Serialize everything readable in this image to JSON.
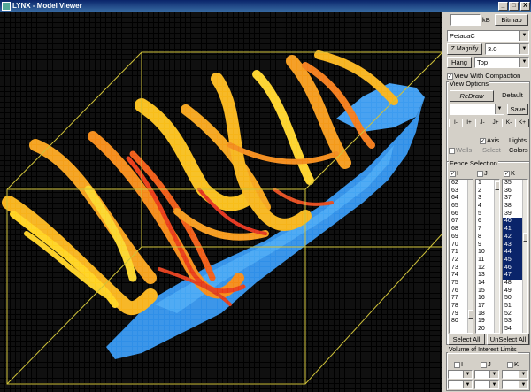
{
  "window": {
    "title": "LYNX - Model Viewer",
    "controls": [
      "_",
      "□",
      "X"
    ]
  },
  "panel": {
    "size_label": "kB",
    "bitmap_label": "Bitmap",
    "model_select": "PetacaC",
    "z_magnify_label": "Z Magnify",
    "z_magnify_value": "3.0",
    "hang_label": "Hang",
    "hang_value": "Top",
    "view_compaction_label": "View With Compaction",
    "view_options_label": "View Options",
    "redraw_label": "ReDraw",
    "default_label": "Default",
    "save_label": "Save",
    "axis_buttons": [
      "I-",
      "I+",
      "J-",
      "J+",
      "K-",
      "K+"
    ],
    "axis_label": "Axis",
    "lights_label": "Lights",
    "wells_label": "Wells",
    "select_label": "Select",
    "colors_label": "Colors",
    "fence_selection_label": "Fence Selection",
    "fence_tabs": [
      "I",
      "J",
      "K"
    ],
    "list_i": [
      "62",
      "63",
      "64",
      "65",
      "66",
      "67",
      "68",
      "69",
      "70",
      "71",
      "72",
      "73",
      "74",
      "75",
      "76",
      "77",
      "78",
      "79",
      "80"
    ],
    "list_j": [
      "1",
      "2",
      "3",
      "4",
      "5",
      "6",
      "7",
      "8",
      "9",
      "10",
      "11",
      "12",
      "13",
      "14",
      "15",
      "16",
      "17",
      "18",
      "19",
      "20"
    ],
    "list_k": [
      "35",
      "36",
      "37",
      "38",
      "39",
      "40",
      "41",
      "42",
      "43",
      "44",
      "45",
      "46",
      "47",
      "48",
      "49",
      "50",
      "51",
      "52",
      "53",
      "54"
    ],
    "list_k_selected": [
      "40",
      "41",
      "42",
      "43",
      "44",
      "45",
      "46",
      "47"
    ],
    "select_all_label": "Select All",
    "unselect_all_label": "UnSelect All",
    "voi_label": "Volume of Interest Limits",
    "voi_axes": [
      "I",
      "J",
      "K"
    ]
  }
}
